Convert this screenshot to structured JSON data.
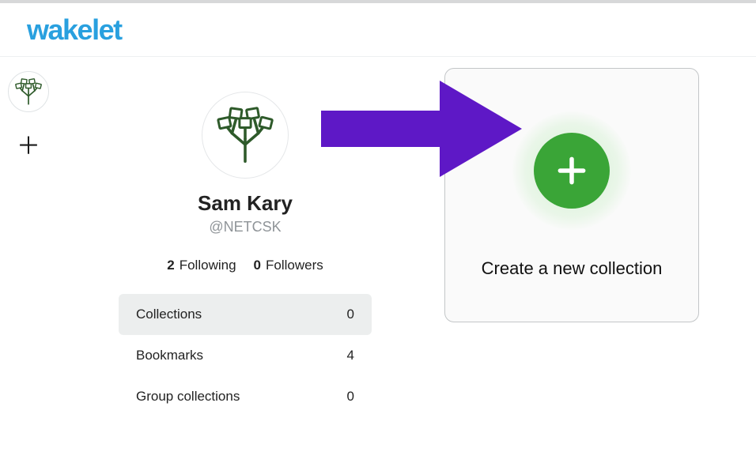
{
  "brand": {
    "name": "wakelet"
  },
  "profile": {
    "display_name": "Sam Kary",
    "handle": "@NETCSK",
    "following_count": "2",
    "following_label": "Following",
    "followers_count": "0",
    "followers_label": "Followers"
  },
  "stats": {
    "collections": {
      "label": "Collections",
      "value": "0"
    },
    "bookmarks": {
      "label": "Bookmarks",
      "value": "4"
    },
    "group": {
      "label": "Group collections",
      "value": "0"
    }
  },
  "card": {
    "label": "Create a new collection"
  },
  "colors": {
    "brand": "#29a0df",
    "accent_green": "#3aa537",
    "arrow": "#5e18c6"
  }
}
